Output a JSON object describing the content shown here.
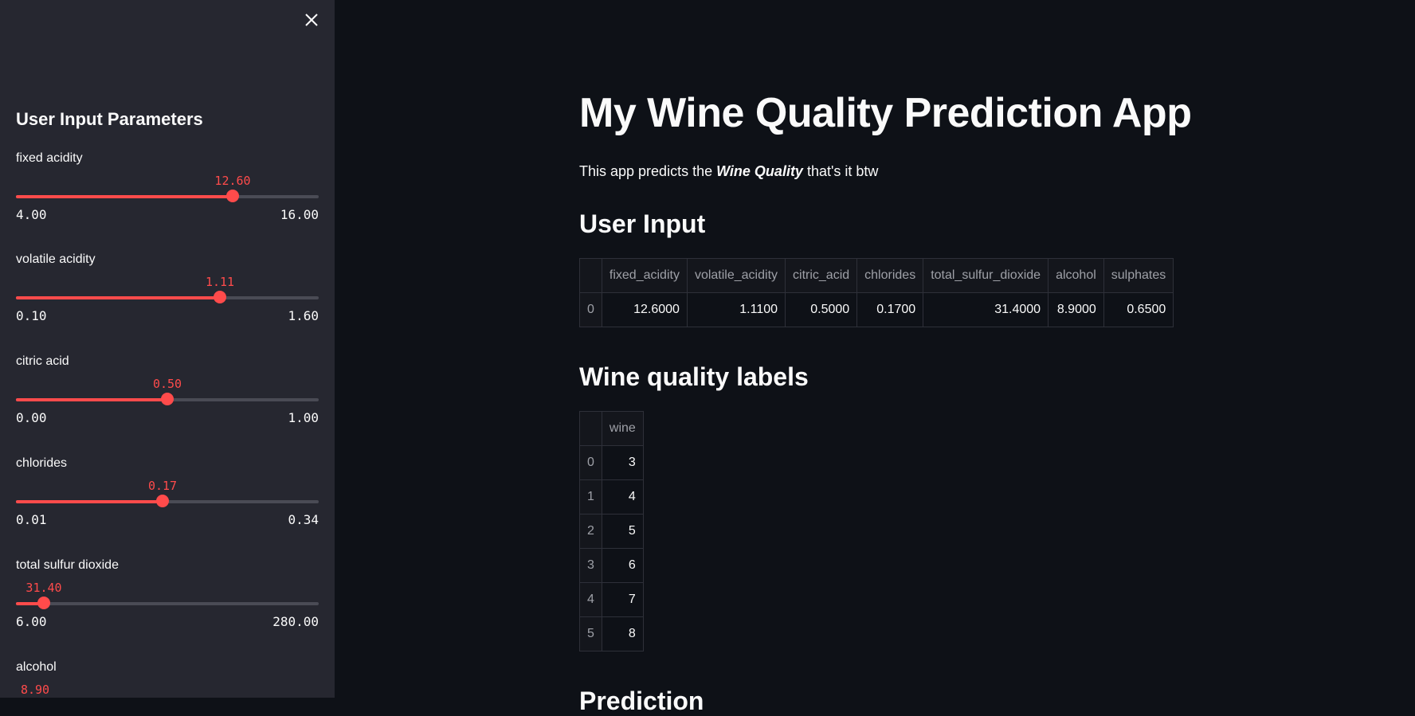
{
  "sidebar": {
    "header": "User Input Parameters",
    "sliders": [
      {
        "label": "fixed acidity",
        "value": "12.60",
        "min": "4.00",
        "max": "16.00",
        "fraction": 0.717
      },
      {
        "label": "volatile acidity",
        "value": "1.11",
        "min": "0.10",
        "max": "1.60",
        "fraction": 0.673
      },
      {
        "label": "citric acid",
        "value": "0.50",
        "min": "0.00",
        "max": "1.00",
        "fraction": 0.5
      },
      {
        "label": "chlorides",
        "value": "0.17",
        "min": "0.01",
        "max": "0.34",
        "fraction": 0.485
      },
      {
        "label": "total sulfur dioxide",
        "value": "31.40",
        "min": "6.00",
        "max": "280.00",
        "fraction": 0.093
      },
      {
        "label": "alcohol",
        "value": "8.90",
        "min": "",
        "max": "",
        "fraction": 0.0
      }
    ]
  },
  "main": {
    "title": "My Wine Quality Prediction App",
    "intro_prefix": "This app predicts the ",
    "intro_emphasis": "Wine Quality",
    "intro_suffix": " that's it btw",
    "user_input_heading": "User Input",
    "user_input_table": {
      "columns": [
        "",
        "fixed_acidity",
        "volatile_acidity",
        "citric_acid",
        "chlorides",
        "total_sulfur_dioxide",
        "alcohol",
        "sulphates"
      ],
      "rows": [
        [
          "0",
          "12.6000",
          "1.1100",
          "0.5000",
          "0.1700",
          "31.4000",
          "8.9000",
          "0.6500"
        ]
      ]
    },
    "labels_heading": "Wine quality labels",
    "labels_table": {
      "columns": [
        "",
        "wine"
      ],
      "rows": [
        [
          "0",
          "3"
        ],
        [
          "1",
          "4"
        ],
        [
          "2",
          "5"
        ],
        [
          "3",
          "6"
        ],
        [
          "4",
          "7"
        ],
        [
          "5",
          "8"
        ]
      ]
    },
    "prediction_heading": "Prediction"
  },
  "colors": {
    "accent": "#ff4b4b",
    "sidebar_bg": "#262730",
    "main_bg": "#0e1117"
  }
}
